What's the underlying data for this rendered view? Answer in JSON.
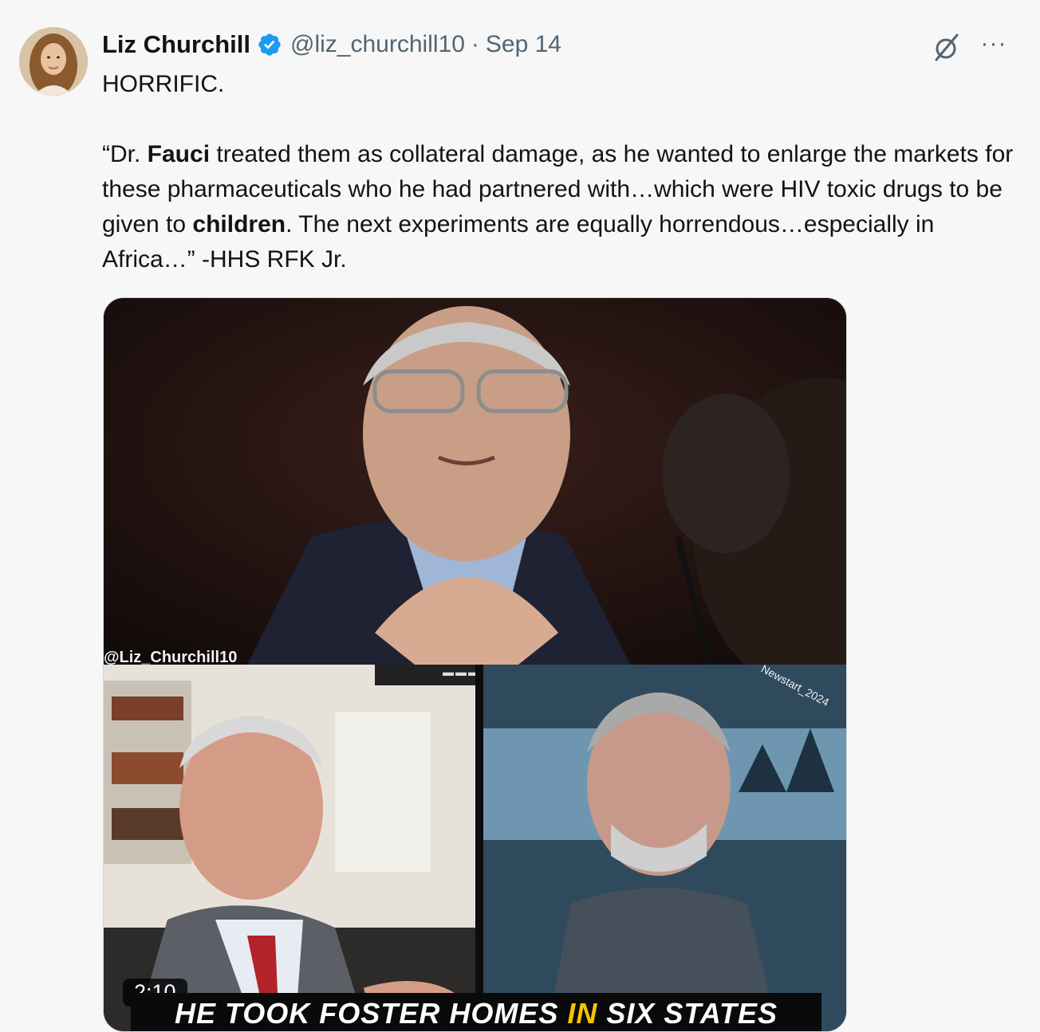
{
  "author": {
    "name": "Liz Churchill",
    "handle": "@liz_churchill10",
    "separator": "·",
    "date": "Sep 14",
    "verified_color": "#1d9bf0"
  },
  "actions": {
    "grok_icon": "grok-icon",
    "more_label": "···"
  },
  "tweet": {
    "line1": "HORRIFIC.",
    "q1": "“Dr. ",
    "q1b": "Fauci",
    "q2": " treated them as collateral damage, as he wanted to enlarge the markets for these pharmaceuticals who he had partnered with…which were HIV toxic drugs to be given to ",
    "q2b": "children",
    "q3": ". The next experiments are equally horrendous…especially in Africa…” -HHS RFK Jr."
  },
  "media": {
    "watermark": "@Liz_Churchill10",
    "duration": "2:10",
    "chyron_pre": "HE TOOK FOSTER HOMES ",
    "chyron_hl": "IN",
    "chyron_post": " SIX STATES",
    "right_mark": "Newstart_2024"
  }
}
